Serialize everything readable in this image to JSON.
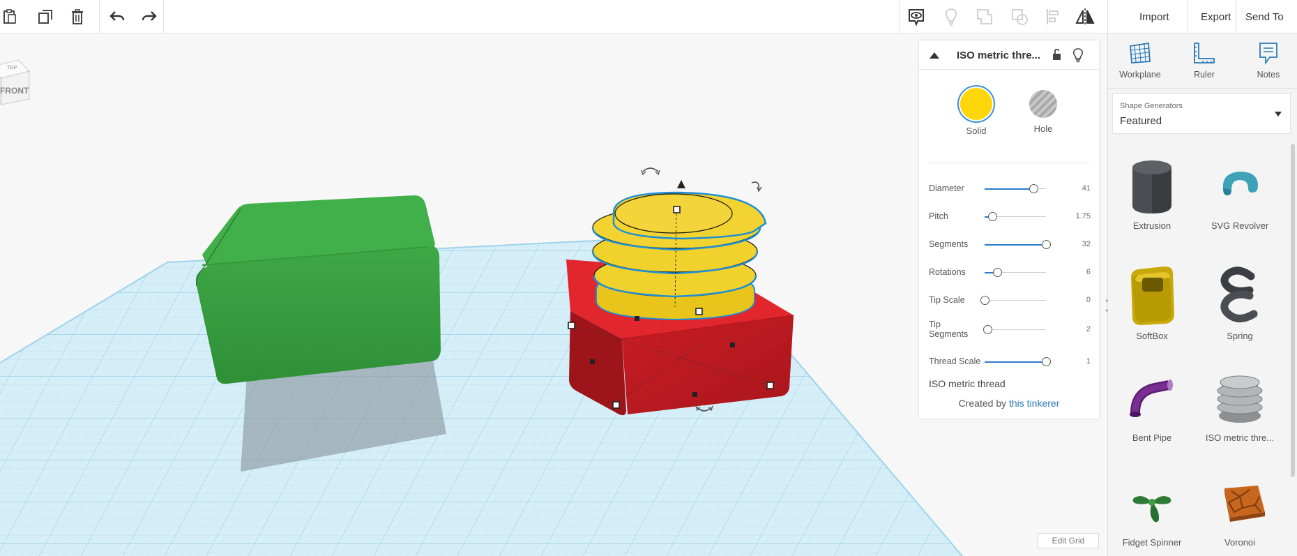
{
  "toolbar": {
    "copy_icon": "clipboard-icon",
    "duplicate_icon": "duplicate-icon",
    "delete_icon": "trash-icon",
    "undo_icon": "undo-icon",
    "redo_icon": "redo-icon",
    "import_label": "Import",
    "export_label": "Export",
    "send_to_label": "Send To"
  },
  "viewport": {
    "viewcube_top": "TOP",
    "viewcube_front": "FRONT",
    "edit_grid_label": "Edit Grid"
  },
  "inspector": {
    "title": "ISO metric thre...",
    "solid_label": "Solid",
    "hole_label": "Hole",
    "solid_color": "#ffd60a",
    "params": [
      {
        "name": "Diameter",
        "value": "41",
        "fraction": 0.8
      },
      {
        "name": "Pitch",
        "value": "1.75",
        "fraction": 0.13
      },
      {
        "name": "Segments",
        "value": "32",
        "fraction": 1.0
      },
      {
        "name": "Rotations",
        "value": "6",
        "fraction": 0.2
      },
      {
        "name": "Tip Scale",
        "value": "0",
        "fraction": 0.0
      },
      {
        "name": "Tip Segments",
        "value": "2",
        "fraction": 0.05
      },
      {
        "name": "Thread Scale",
        "value": "1",
        "fraction": 1.0
      }
    ],
    "shape_name": "ISO metric thread",
    "credit_prefix": "Created by",
    "credit_link": "this tinkerer"
  },
  "right_panel": {
    "tools": [
      {
        "label": "Workplane",
        "icon": "workplane-icon"
      },
      {
        "label": "Ruler",
        "icon": "ruler-icon"
      },
      {
        "label": "Notes",
        "icon": "notes-icon"
      }
    ],
    "dropdown_label": "Shape Generators",
    "dropdown_value": "Featured",
    "shapes": [
      {
        "label": "Extrusion"
      },
      {
        "label": "SVG Revolver"
      },
      {
        "label": "SoftBox"
      },
      {
        "label": "Spring"
      },
      {
        "label": "Bent Pipe"
      },
      {
        "label": "ISO metric thre..."
      },
      {
        "label": "Fidget Spinner"
      },
      {
        "label": "Voronoi"
      }
    ]
  },
  "colors": {
    "accent": "#2a7ab9",
    "green_box": "#3aa542",
    "red_box": "#c41e24",
    "thread_yellow": "#f2d12f",
    "grid": "#cfe9f5"
  }
}
